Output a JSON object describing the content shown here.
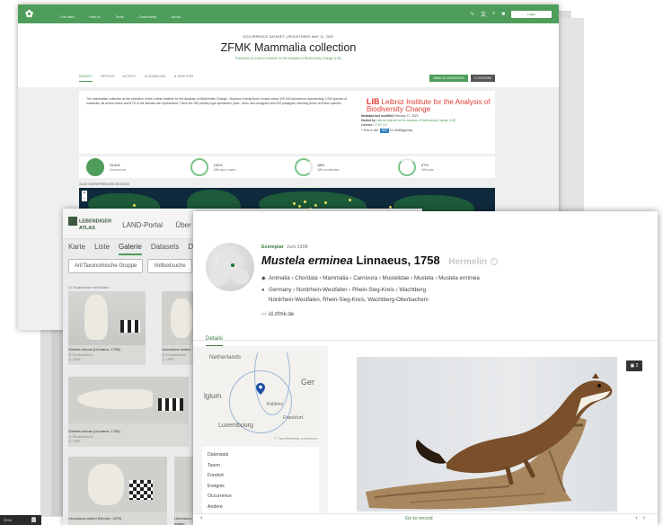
{
  "gbif": {
    "nav": [
      "Get data",
      "How-to",
      "Tools",
      "Community",
      "About"
    ],
    "login": "Login",
    "pretitle": "OCCURRENCE DATASET  |  REGISTERED MAY 11, 2022",
    "title": "ZFMK Mammalia collection",
    "publisher": "Published by Leibniz Institute for the Analysis of Biodiversity Change (LIB)",
    "tabs": [
      "DATASET",
      "METRICS",
      "ACTIVITY",
      "⬇ DOWNLOAD",
      "⊕ VIEW ITEM"
    ],
    "buttons": {
      "occurrences": "34626 OCCURRENCES",
      "citations": "0 CITATIONS"
    },
    "description": "The mammalian collection at the collection of the Leibniz Institute for the Analysis of Biodiversity Change - Museum Koenig Bonn houses about 100,000 specimens representing 1,000 species of mammals; all recent orders and 87% of the families are represented. There are 150 primary type specimens (holo-, lecto- and neotypes) and 400 paratypes including those of extinct species.",
    "lib_logo": "LIB",
    "lib_name": "Leibniz Institute for the Analysis of Biodiversity Change",
    "meta": {
      "metadata_label": "Metadata last modified",
      "metadata_value": "February 17, 2023",
      "hosted_label": "Hosted by",
      "hosted_value": "Leibniz Institute for the Analysis of Biodiversity Change (LIB)",
      "licence_label": "Licence",
      "licence_value": "CC BY 4.0",
      "howto": "How to cite",
      "doi_badge": "DOI",
      "doi_value": "10.15468/gpeexp"
    },
    "stats": [
      {
        "value": "34,626",
        "label": "Occurrences"
      },
      {
        "value": "100%",
        "label": "With taxon match"
      },
      {
        "value": "88%",
        "label": "With coordinates"
      },
      {
        "value": "87%",
        "label": "With year"
      }
    ],
    "map_label": "CLICK GEOREFERENCED RECORDS"
  },
  "atlas": {
    "logo_line1": "LEBENDIGER",
    "logo_line2": "ATLAS",
    "menu": [
      "LAND-Portal",
      "Über",
      "A"
    ],
    "tabs": [
      "Karte",
      "Liste",
      "Galerie",
      "Datasets",
      "Do"
    ],
    "filters": [
      "Art/Taxonomische Gruppe",
      "Volltextsuche"
    ],
    "result_count": "22 Ergebnisse mit Bildern",
    "cards": [
      {
        "name": "Gazella dorcas (Linnaeus, 1758)",
        "country": "Deutschland",
        "year": "1959"
      },
      {
        "name": "Litocranius walleri",
        "country": "Deutschland",
        "year": "1959"
      },
      {
        "name": "Gazella dorcas (Linnaeus, 1758)",
        "country": "Deutschland",
        "year": "1996"
      },
      {
        "name": "Litocranius walleri (Brooke, 1879)",
        "country": "Deutschland",
        "year": ""
      },
      {
        "name": "Litocranius walleri",
        "country": "",
        "year": ""
      }
    ]
  },
  "detail": {
    "kind": "Exemplar",
    "date": "Juni 1998",
    "scientific_name": "Mustela erminea",
    "author": "Linnaeus, 1758",
    "vernacular": "Hermelin",
    "taxonomy": "Animalia › Chordata › Mammalia › Carnivora › Mustelidae › Mustela › Mustela erminea",
    "location_line1": "Germany › Nordrhein-Westfalen › Rhein-Sieg-Kreis › Wachtberg",
    "location_line2": "Nordrhein-Westfalen, Rhein-Sieg-Kreis, Wachtberg-Oberbachem",
    "source": "id.zfmk.de",
    "tab": "Details",
    "map_labels": {
      "north": "Netherlands",
      "west": "lgium",
      "lux": "Luxembourg",
      "east": "Ger",
      "koblenz": "Koblenz",
      "frankfurt": "Frankfurt",
      "attribution": "© OpenStreetMap contributors"
    },
    "sections": [
      "Datensatz",
      "Taxon",
      "Fundort",
      "Ereignis",
      "Occurrence",
      "Andere"
    ],
    "image_count": "2",
    "footer_link": "Go to record"
  },
  "taskbar": {
    "label": "2024"
  },
  "colors": {
    "gbif_green": "#4e9d5a",
    "atlas_green": "#3b7d46",
    "lib_red": "#e03c31"
  }
}
